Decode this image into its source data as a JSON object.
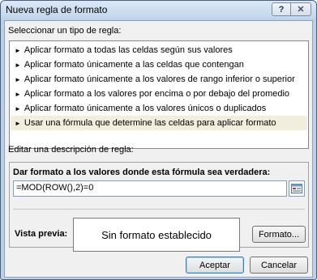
{
  "window": {
    "title": "Nueva regla de formato",
    "help_label": "?",
    "close_label": "✕"
  },
  "rule_type": {
    "section_label": "Seleccionar un tipo de regla:",
    "items": [
      {
        "label": "Aplicar formato a todas las celdas según sus valores",
        "selected": false
      },
      {
        "label": "Aplicar formato únicamente a las celdas que contengan",
        "selected": false
      },
      {
        "label": "Aplicar formato únicamente a los valores de rango inferior o superior",
        "selected": false
      },
      {
        "label": "Aplicar formato a los valores por encima o por debajo del promedio",
        "selected": false
      },
      {
        "label": "Aplicar formato únicamente a los valores únicos o duplicados",
        "selected": false
      },
      {
        "label": "Usar una fórmula que determine las celdas para aplicar formato",
        "selected": true
      }
    ],
    "arrow_glyph": "►"
  },
  "description": {
    "section_label": "Editar una descripción de regla:",
    "formula_header": "Dar formato a los valores donde esta fórmula sea verdadera:",
    "formula_value": "=MOD(ROW(),2)=0",
    "preview_label": "Vista previa:",
    "preview_text": "Sin formato establecido",
    "format_button": "Formato...",
    "ref_icon": "collapse-dialog-icon"
  },
  "footer": {
    "accept_label": "Aceptar",
    "cancel_label": "Cancelar"
  }
}
